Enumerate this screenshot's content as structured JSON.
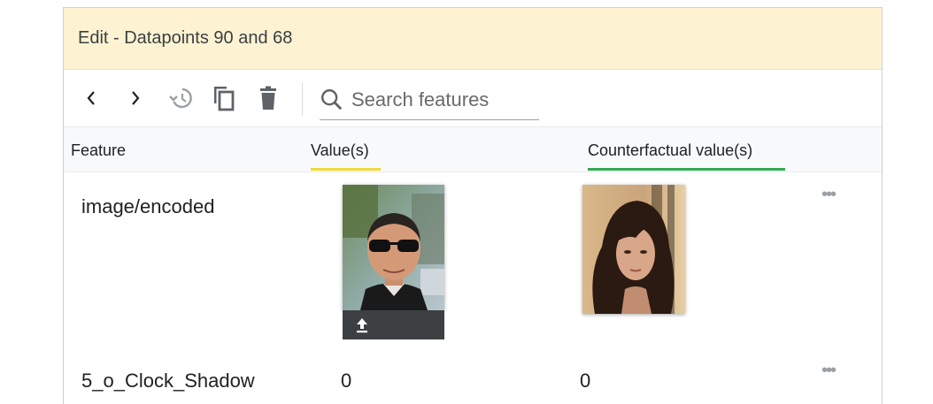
{
  "header": {
    "title": "Edit - Datapoints 90 and 68"
  },
  "toolbar": {
    "icons": [
      "chevron-left-icon",
      "chevron-right-icon",
      "history-icon",
      "copy-icon",
      "delete-icon"
    ]
  },
  "search": {
    "placeholder": "Search features",
    "value": ""
  },
  "columns": {
    "feature": "Feature",
    "values": "Value(s)",
    "counterfactual": "Counterfactual value(s)"
  },
  "rows": [
    {
      "feature": "image/encoded",
      "value": "",
      "counterfactual": ""
    },
    {
      "feature": "5_o_Clock_Shadow",
      "value": "0",
      "counterfactual": "0"
    }
  ],
  "colors": {
    "header_bg": "#fdf3d2",
    "value_underline": "#f0d93a",
    "counterfactual_underline": "#34a853",
    "upload_bar": "#3c4043"
  }
}
